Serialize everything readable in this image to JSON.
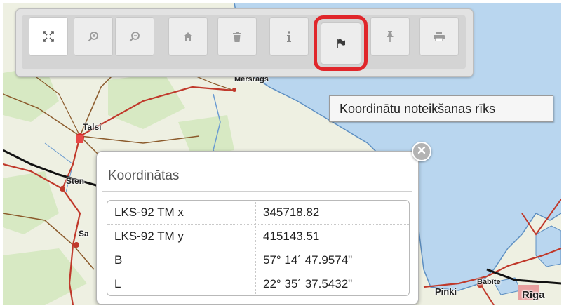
{
  "toolbar": {
    "buttons": [
      {
        "name": "zoom-to-extent",
        "icon": "fullscreen-arrows-icon",
        "active": true
      },
      {
        "name": "zoom-in",
        "icon": "zoom-in-icon",
        "active": false
      },
      {
        "name": "zoom-out",
        "icon": "zoom-out-icon",
        "active": false
      },
      {
        "name": "home",
        "icon": "home-icon",
        "active": false
      },
      {
        "name": "clear",
        "icon": "trash-icon",
        "active": false
      },
      {
        "name": "info",
        "icon": "info-icon",
        "active": false
      },
      {
        "name": "coordinates",
        "icon": "flag-icon",
        "active": false,
        "highlighted": true
      },
      {
        "name": "pin",
        "icon": "pin-icon",
        "active": false
      },
      {
        "name": "print",
        "icon": "print-icon",
        "active": false
      }
    ],
    "highlight_color": "#e0262b"
  },
  "tooltip": {
    "text": "Koordinātu noteikšanas rīks"
  },
  "map": {
    "place_labels": [
      "Talsi",
      "Mērsrags",
      "Sten",
      "Sa",
      "Pinki",
      "Babīte",
      "Rīga"
    ],
    "colors": {
      "land": "#eef0e2",
      "sea": "#b9d6ef",
      "road_main": "#c0392b",
      "road_secondary": "#8b5a2b",
      "forest": "#cfe5b8",
      "railway": "#111111"
    }
  },
  "popup": {
    "title": "Koordinātas",
    "rows": [
      {
        "label": "LKS-92 TM x",
        "value": "345718.82"
      },
      {
        "label": "LKS-92 TM y",
        "value": "415143.51"
      },
      {
        "label": "B",
        "value": "57° 14´ 47.9574\""
      },
      {
        "label": "L",
        "value": "22° 35´ 37.5432\""
      }
    ]
  }
}
